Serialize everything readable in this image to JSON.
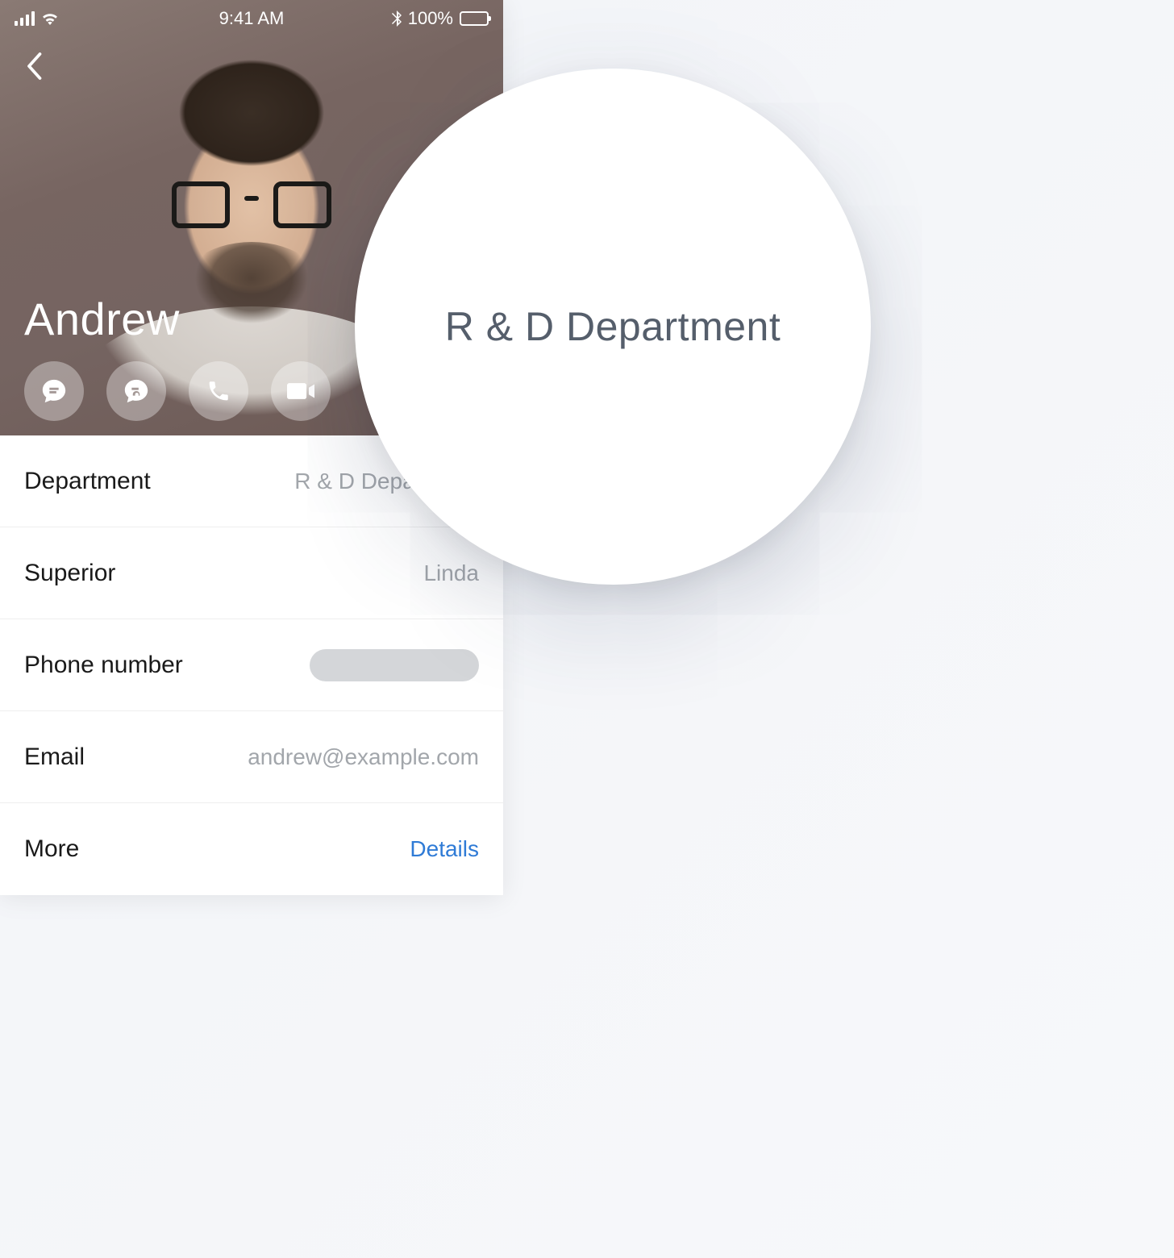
{
  "statusBar": {
    "time": "9:41 AM",
    "batteryText": "100%"
  },
  "contact": {
    "name": "Andrew"
  },
  "actions": {
    "chat": "chat",
    "secureChat": "secure-chat",
    "call": "call",
    "video": "video"
  },
  "details": {
    "departmentLabel": "Department",
    "departmentValue": "R & D Department",
    "superiorLabel": "Superior",
    "superiorValue": "Linda",
    "phoneLabel": "Phone number",
    "emailLabel": "Email",
    "emailValue": "andrew@example.com",
    "moreLabel": "More",
    "moreLink": "Details"
  },
  "zoom": {
    "text": "R & D Department"
  }
}
